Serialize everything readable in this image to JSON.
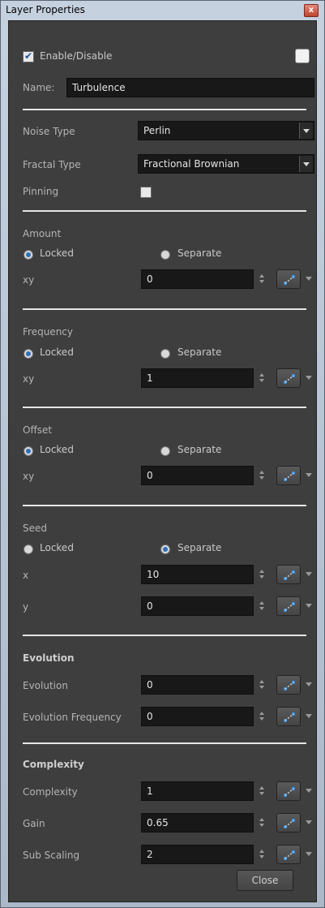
{
  "window": {
    "title": "Layer Properties",
    "close_glyph": "x"
  },
  "enable": {
    "label": "Enable/Disable",
    "checked": true
  },
  "name": {
    "label": "Name:",
    "value": "Turbulence"
  },
  "noise_type": {
    "label": "Noise Type",
    "value": "Perlin"
  },
  "fractal_type": {
    "label": "Fractal Type",
    "value": "Fractional Brownian"
  },
  "pinning": {
    "label": "Pinning",
    "checked": false
  },
  "amount": {
    "header": "Amount",
    "locked": "Locked",
    "separate": "Separate",
    "mode": "locked",
    "field_label": "xy",
    "value": "0"
  },
  "frequency": {
    "header": "Frequency",
    "locked": "Locked",
    "separate": "Separate",
    "mode": "locked",
    "field_label": "xy",
    "value": "1"
  },
  "offset": {
    "header": "Offset",
    "locked": "Locked",
    "separate": "Separate",
    "mode": "locked",
    "field_label": "xy",
    "value": "0"
  },
  "seed": {
    "header": "Seed",
    "locked": "Locked",
    "separate": "Separate",
    "mode": "separate",
    "x_label": "x",
    "x_value": "10",
    "y_label": "y",
    "y_value": "0"
  },
  "evolution": {
    "header": "Evolution",
    "evolution_label": "Evolution",
    "evolution_value": "0",
    "frequency_label": "Evolution Frequency",
    "frequency_value": "0"
  },
  "complexity": {
    "header": "Complexity",
    "complexity_label": "Complexity",
    "complexity_value": "1",
    "gain_label": "Gain",
    "gain_value": "0.65",
    "sub_scaling_label": "Sub Scaling",
    "sub_scaling_value": "2"
  },
  "footer": {
    "close_label": "Close"
  },
  "icons": {
    "function_button": "function-curve-icon",
    "spinner": "spin-arrows-icon",
    "dropdown": "chevron-down-icon"
  },
  "colors": {
    "panel_bg": "#3e3e3e",
    "field_bg": "#181818",
    "radio_selected": "#2d6fb8",
    "separator": "#e6e6e6"
  }
}
